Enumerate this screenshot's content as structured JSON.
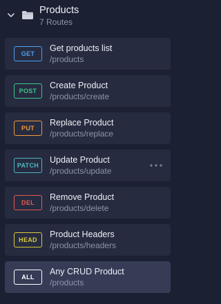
{
  "group": {
    "title": "Products",
    "subtitle": "7 Routes",
    "chevron_icon": "chevron-down-icon",
    "folder_icon": "folder-icon"
  },
  "routes": [
    {
      "method": "GET",
      "title": "Get products list",
      "path": "/products",
      "color": "#4da0f0",
      "active": false,
      "show_more": false
    },
    {
      "method": "POST",
      "title": "Create Product",
      "path": "/products/create",
      "color": "#3fc58a",
      "active": false,
      "show_more": false
    },
    {
      "method": "PUT",
      "title": "Replace Product",
      "path": "/products/replace",
      "color": "#f19a3e",
      "active": false,
      "show_more": false
    },
    {
      "method": "PATCH",
      "title": "Update Product",
      "path": "/products/update",
      "color": "#4fb8c0",
      "active": false,
      "show_more": true
    },
    {
      "method": "DEL",
      "title": "Remove Product",
      "path": "/products/delete",
      "color": "#e8594f",
      "active": false,
      "show_more": false
    },
    {
      "method": "HEAD",
      "title": "Product Headers",
      "path": "/products/headers",
      "color": "#d9cb3c",
      "active": false,
      "show_more": false
    },
    {
      "method": "ALL",
      "title": "Any CRUD Product",
      "path": "/products",
      "color": "#ffffff",
      "active": true,
      "show_more": false
    }
  ],
  "more_icon": "more-horizontal-icon"
}
